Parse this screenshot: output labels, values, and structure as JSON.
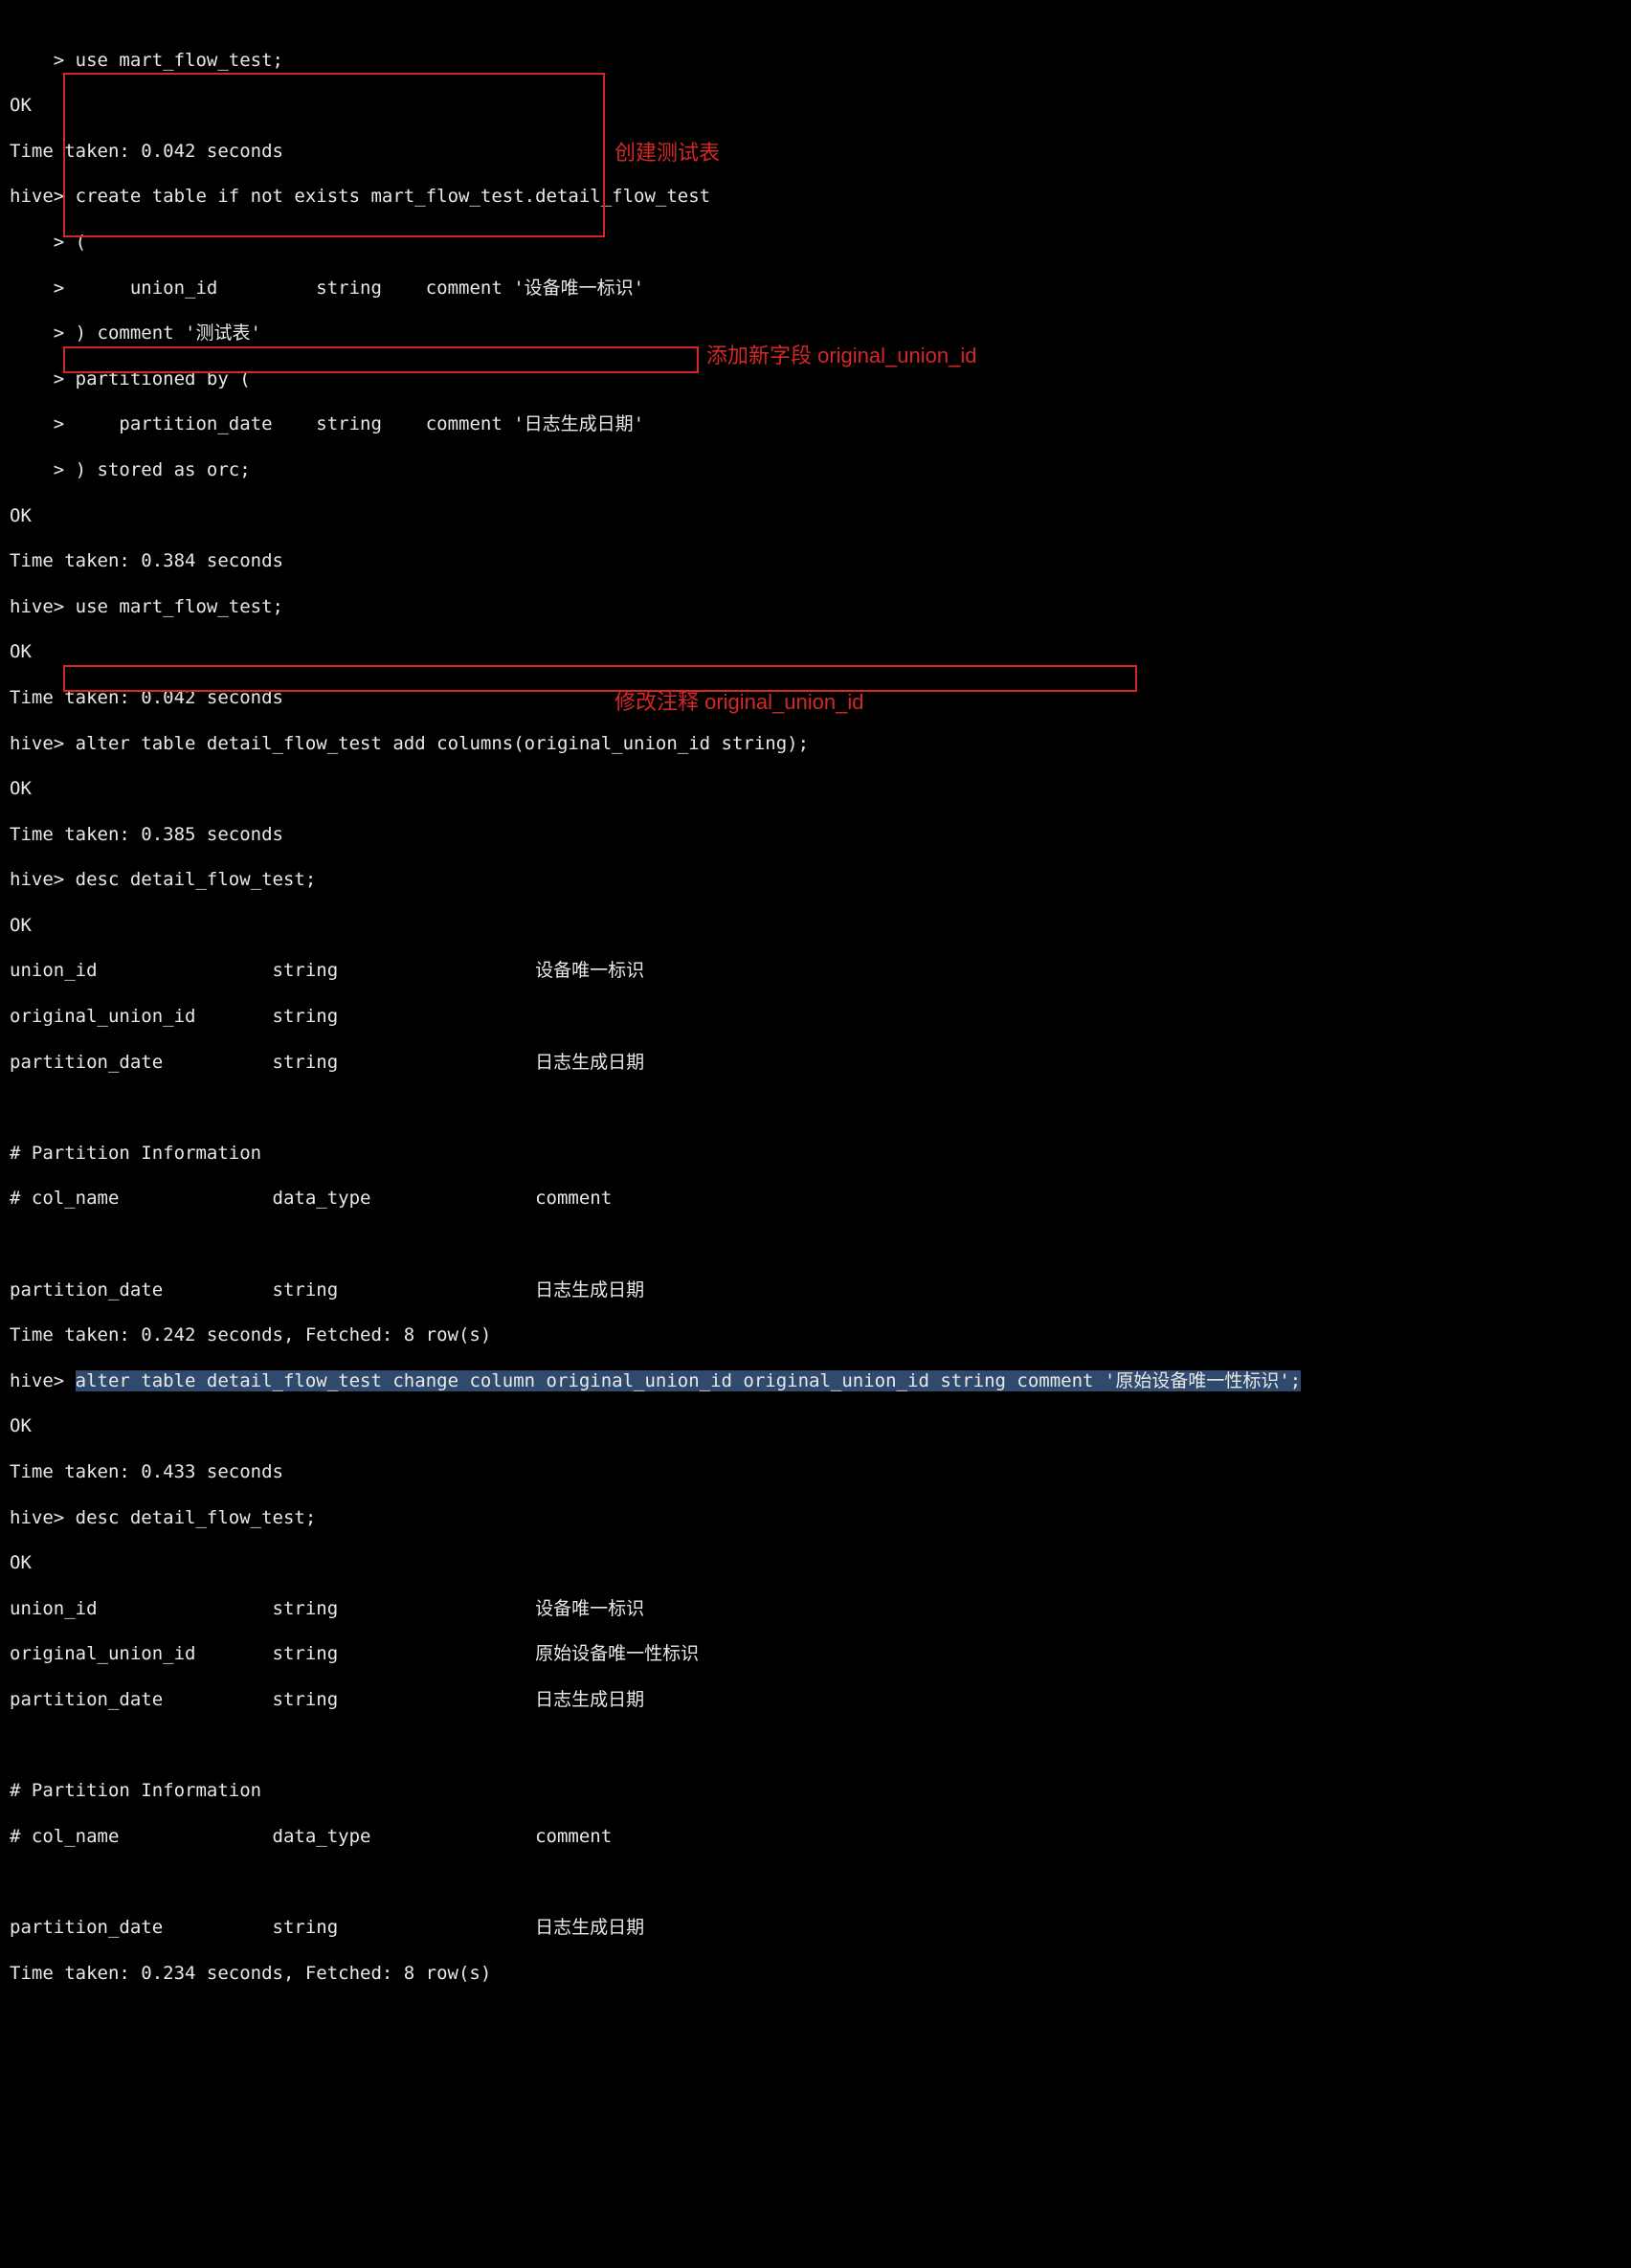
{
  "prompt_cont": "    > ",
  "prompt_hive": "hive> ",
  "ok": "OK",
  "lines": {
    "l00": "use mart_flow_test;",
    "l02": "Time taken: 0.042 seconds",
    "l03": "create table if not exists mart_flow_test.detail_flow_test",
    "l04": "(",
    "l05": "     union_id         string    comment '设备唯一标识'",
    "l06": ") comment '测试表'",
    "l07": "partitioned by (",
    "l08": "    partition_date    string    comment '日志生成日期'",
    "l09": ") stored as orc;",
    "l11": "Time taken: 0.384 seconds",
    "l12": "use mart_flow_test;",
    "l14": "Time taken: 0.042 seconds",
    "l15": "alter table detail_flow_test add columns(original_union_id string);",
    "l17": "Time taken: 0.385 seconds",
    "l18": "desc detail_flow_test;",
    "l20": "union_id            \tstring              \t设备唯一标识",
    "l21": "original_union_id   \tstring              \t",
    "l22": "partition_date      \tstring              \t日志生成日期",
    "l24": "# Partition Information",
    "l25": "# col_name            \tdata_type           \tcomment",
    "l27": "partition_date      \tstring              \t日志生成日期",
    "l28": "Time taken: 0.242 seconds, Fetched: 8 row(s)",
    "l29": "alter table detail_flow_test change column original_union_id original_union_id string comment '原始设备唯一性标识';",
    "l31": "Time taken: 0.433 seconds",
    "l32": "desc detail_flow_test;",
    "l34": "union_id            \tstring              \t设备唯一标识",
    "l35": "original_union_id   \tstring              \t原始设备唯一性标识",
    "l36": "partition_date      \tstring              \t日志生成日期",
    "l38": "# Partition Information",
    "l39": "# col_name            \tdata_type           \tcomment",
    "l41": "partition_date      \tstring              \t日志生成日期",
    "l42": "Time taken: 0.234 seconds, Fetched: 8 row(s)"
  },
  "annotations": {
    "a1": "创建测试表",
    "a2": "添加新字段 original_union_id",
    "a3": "修改注释 original_union_id"
  }
}
